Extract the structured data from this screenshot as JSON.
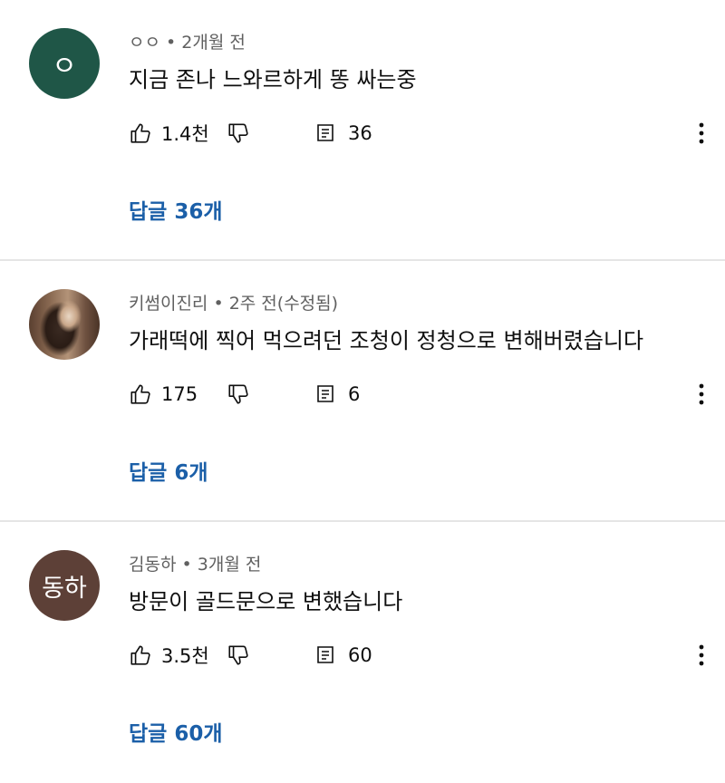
{
  "comments": [
    {
      "avatar_text": "ㅇ",
      "avatar_color": "#1f5647",
      "author": "ㅇㅇ",
      "time": "2개월 전",
      "text": "지금 존나 느와르하게 똥 싸는중",
      "likes": "1.4천",
      "reply_count": "36",
      "replies_link": "답글 36개"
    },
    {
      "avatar_text": "",
      "avatar_color": "#6e5140",
      "author": "키썸이진리",
      "time": "2주 전(수정됨)",
      "text": "가래떡에 찍어 먹으려던 조청이 정청으로 변해버렸습니다",
      "likes": "175",
      "reply_count": "6",
      "replies_link": "답글 6개"
    },
    {
      "avatar_text": "동하",
      "avatar_color": "#5d4037",
      "author": "김동하",
      "time": "3개월 전",
      "text": "방문이 골드문으로 변했습니다",
      "likes": "3.5천",
      "reply_count": "60",
      "replies_link": "답글 60개"
    }
  ],
  "separator": " • ",
  "icons": {
    "like": "thumb-up-icon",
    "dislike": "thumb-down-icon",
    "replies": "comment-icon",
    "more": "more-vertical-icon"
  },
  "colors": {
    "link": "#1b5fa8",
    "meta": "#606060",
    "divider": "#e5e5e5"
  }
}
